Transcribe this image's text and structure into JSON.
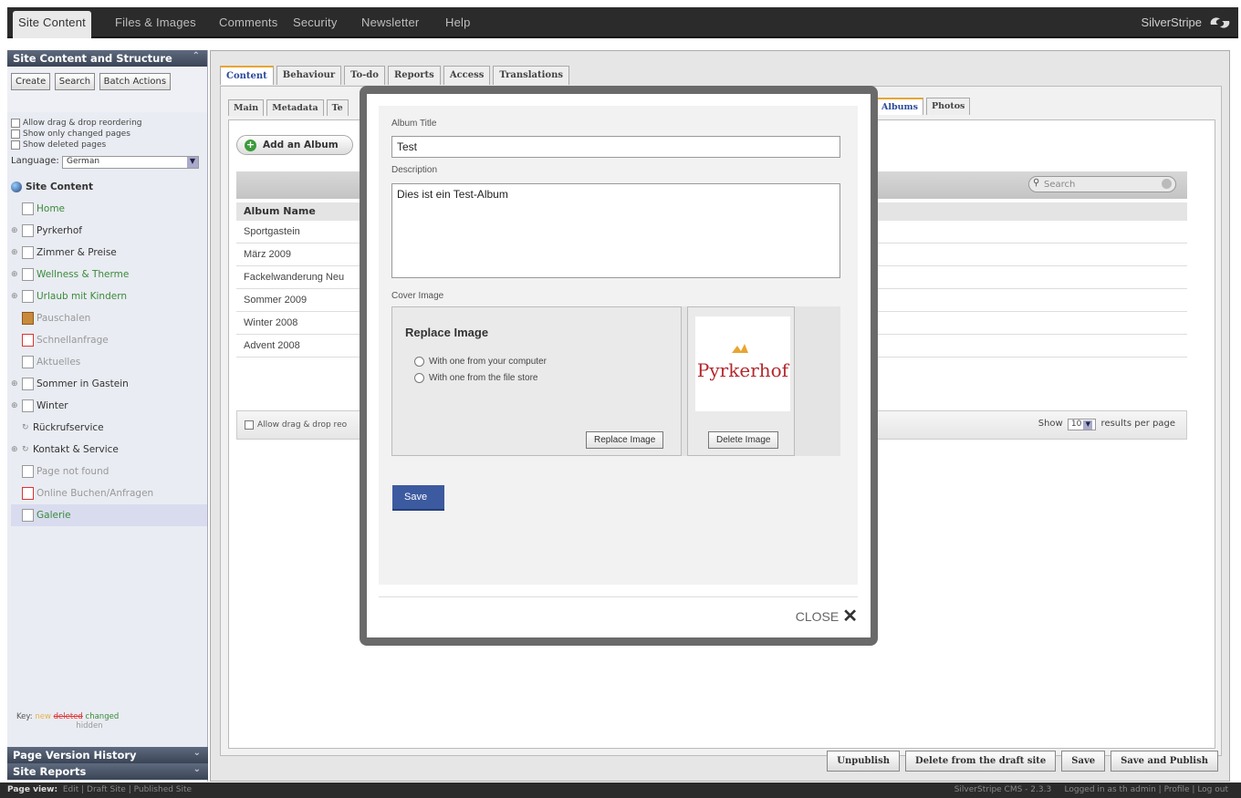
{
  "topnav": {
    "items": [
      "Site Content",
      "Files & Images",
      "Comments",
      "Security",
      "Newsletter",
      "Help"
    ],
    "brand": "SilverStripe"
  },
  "left": {
    "header": "Site Content and Structure",
    "buttons": [
      "Create",
      "Search",
      "Batch Actions"
    ],
    "options": [
      "Allow drag & drop reordering",
      "Show only changed pages",
      "Show deleted pages"
    ],
    "language_label": "Language:",
    "language_value": "German",
    "tree": [
      {
        "label": "Site Content"
      },
      {
        "label": "Home"
      },
      {
        "label": "Pyrkerhof"
      },
      {
        "label": "Zimmer & Preise"
      },
      {
        "label": "Wellness & Therme"
      },
      {
        "label": "Urlaub mit Kindern"
      },
      {
        "label": "Pauschalen"
      },
      {
        "label": "Schnellanfrage"
      },
      {
        "label": "Aktuelles"
      },
      {
        "label": "Sommer in Gastein"
      },
      {
        "label": "Winter"
      },
      {
        "label": "Rückrufservice"
      },
      {
        "label": "Kontakt & Service"
      },
      {
        "label": "Page not found"
      },
      {
        "label": "Online Buchen/Anfragen"
      },
      {
        "label": "Galerie"
      }
    ],
    "key": {
      "label": "Key:",
      "new": "new",
      "deleted": "deleted",
      "changed": "changed",
      "hidden": "hidden"
    },
    "bottom_headers": [
      "Page Version History",
      "Site Reports"
    ]
  },
  "main": {
    "tabs": [
      "Content",
      "Behaviour",
      "To-do",
      "Reports",
      "Access",
      "Translations"
    ],
    "subtabs": [
      "Main",
      "Metadata",
      "Te"
    ],
    "subtabs_right": [
      "Albums",
      "Photos"
    ],
    "add_album": "Add an Album",
    "search_placeholder": "Search",
    "column_header": "Album Name",
    "rows": [
      "Sportgastein",
      "März 2009",
      "Fackelwanderung Neu",
      "Sommer 2009",
      "Winter 2008",
      "Advent 2008"
    ],
    "footer_checkbox": "Allow drag & drop reo",
    "show_label": "Show",
    "per_page_value": "10",
    "per_page_label": "results per page",
    "actions": [
      "Unpublish",
      "Delete from the draft site",
      "Save",
      "Save and Publish"
    ]
  },
  "bottombar": {
    "label": "Page view:",
    "links": [
      "Edit",
      "Draft Site",
      "Published Site"
    ],
    "version": "SilverStripe CMS - 2.3.3",
    "logged": "Logged in as th admin | Profile | Log out"
  },
  "modal": {
    "album_title_label": "Album Title",
    "album_title_value": "Test",
    "description_label": "Description",
    "description_value": "Dies ist ein Test-Album",
    "cover_label": "Cover Image",
    "replace_heading": "Replace Image",
    "radio_options": [
      "With one from your computer",
      "With one from the file store"
    ],
    "replace_button": "Replace Image",
    "delete_button": "Delete Image",
    "thumb_text": "Pyrkerhof",
    "save_button": "Save",
    "close_label": "CLOSE"
  }
}
